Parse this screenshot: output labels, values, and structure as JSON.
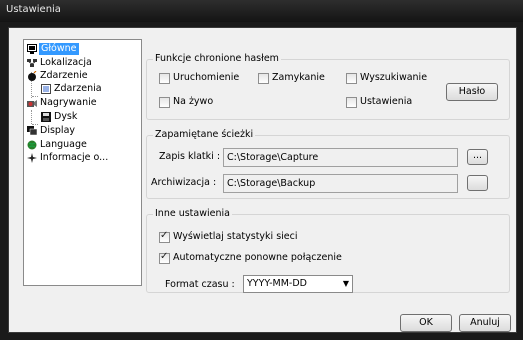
{
  "window": {
    "title": "Ustawienia"
  },
  "tree": {
    "items": [
      {
        "label": "Główne",
        "icon": "monitor-icon",
        "selected": true
      },
      {
        "label": "Lokalizacja",
        "icon": "network-icon"
      },
      {
        "label": "Zdarzenie",
        "icon": "bomb-icon"
      },
      {
        "label": "Zdarzenia",
        "icon": "event-list-icon"
      },
      {
        "label": "Nagrywanie",
        "icon": "record-icon"
      },
      {
        "label": "Dysk",
        "icon": "disk-icon"
      },
      {
        "label": "Display",
        "icon": "display-icon"
      },
      {
        "label": "Language",
        "icon": "globe-icon"
      },
      {
        "label": "Informacje o...",
        "icon": "info-icon"
      }
    ]
  },
  "password_group": {
    "title": "Funkcje chronione hasłem",
    "options": [
      {
        "label": "Uruchomienie",
        "checked": false
      },
      {
        "label": "Zamykanie",
        "checked": false
      },
      {
        "label": "Wyszukiwanie",
        "checked": false
      },
      {
        "label": "Na żywo",
        "checked": false
      },
      {
        "label": "Ustawienia",
        "checked": false
      }
    ],
    "password_button": "Hasło"
  },
  "paths_group": {
    "title": "Zapamiętane ścieżki",
    "snapshot_label": "Zapis klatki :",
    "snapshot_value": "C:\\Storage\\Capture",
    "browse1": "...",
    "archive_label": "Archiwizacja :",
    "archive_value": "C:\\Storage\\Backup",
    "browse2": ""
  },
  "other_group": {
    "title": "Inne ustawienia",
    "show_network_stats": {
      "label": "Wyświetlaj statystyki sieci",
      "checked": true
    },
    "auto_reconnect": {
      "label": "Automatyczne ponowne połączenie",
      "checked": true
    },
    "time_format_label": "Format czasu :",
    "time_format_value": "YYYY-MM-DD"
  },
  "footer": {
    "ok_label": "OK",
    "cancel_label": "Anuluj"
  }
}
